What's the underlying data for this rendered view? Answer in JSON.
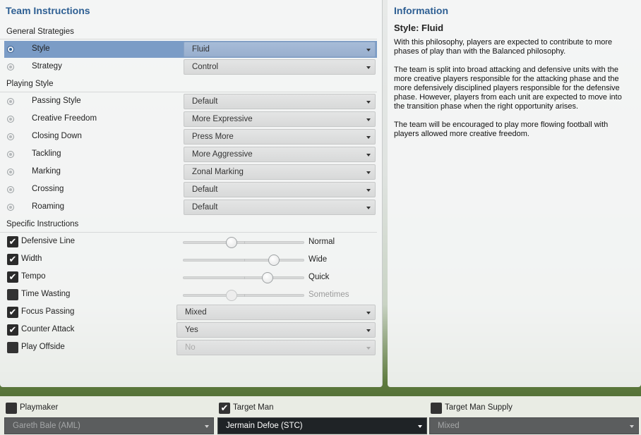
{
  "left_panel": {
    "title": "Team Instructions",
    "general_strategies": {
      "heading": "General Strategies",
      "rows": [
        {
          "label": "Style",
          "value": "Fluid",
          "selected": true
        },
        {
          "label": "Strategy",
          "value": "Control",
          "selected": false
        }
      ]
    },
    "playing_style": {
      "heading": "Playing Style",
      "rows": [
        {
          "label": "Passing Style",
          "value": "Default"
        },
        {
          "label": "Creative Freedom",
          "value": "More Expressive"
        },
        {
          "label": "Closing Down",
          "value": "Press More"
        },
        {
          "label": "Tackling",
          "value": "More Aggressive"
        },
        {
          "label": "Marking",
          "value": "Zonal Marking"
        },
        {
          "label": "Crossing",
          "value": "Default"
        },
        {
          "label": "Roaming",
          "value": "Default"
        }
      ]
    },
    "specific_instructions": {
      "heading": "Specific Instructions",
      "sliders": [
        {
          "label": "Defensive Line",
          "checked": true,
          "value_text": "Normal",
          "level": 0.4
        },
        {
          "label": "Width",
          "checked": true,
          "value_text": "Wide",
          "level": 0.75
        },
        {
          "label": "Tempo",
          "checked": true,
          "value_text": "Quick",
          "level": 0.7
        },
        {
          "label": "Time Wasting",
          "checked": false,
          "value_text": "Sometimes",
          "level": 0.4
        }
      ],
      "dropdowns": [
        {
          "label": "Focus Passing",
          "checked": true,
          "value": "Mixed"
        },
        {
          "label": "Counter Attack",
          "checked": true,
          "value": "Yes"
        },
        {
          "label": "Play Offside",
          "checked": false,
          "value": "No"
        }
      ]
    }
  },
  "right_panel": {
    "title": "Information",
    "subtitle": "Style: Fluid",
    "paragraphs": [
      "With this philosophy, players are expected to contribute to more phases of play than with the Balanced philosophy.",
      "The team is split into broad attacking and defensive units with the more creative players responsible for the attacking phase and the more defensively disciplined players responsible for the defensive phase. However, players from each unit are expected to move into the transition phase when the right opportunity arises.",
      "The team will be encouraged to play more flowing football with players allowed more creative freedom."
    ]
  },
  "bottom_bar": [
    {
      "label": "Playmaker",
      "checked": false,
      "value": "Gareth Bale (AML)"
    },
    {
      "label": "Target Man",
      "checked": true,
      "value": "Jermain Defoe (STC)"
    },
    {
      "label": "Target Man Supply",
      "checked": false,
      "value": "Mixed"
    }
  ],
  "icons": {
    "check": "✔",
    "radio": "radio-icon",
    "dropdown": "chevron-down-icon"
  },
  "colors": {
    "accent": "#2e5f93",
    "selected_row": "#7b9cc6"
  }
}
